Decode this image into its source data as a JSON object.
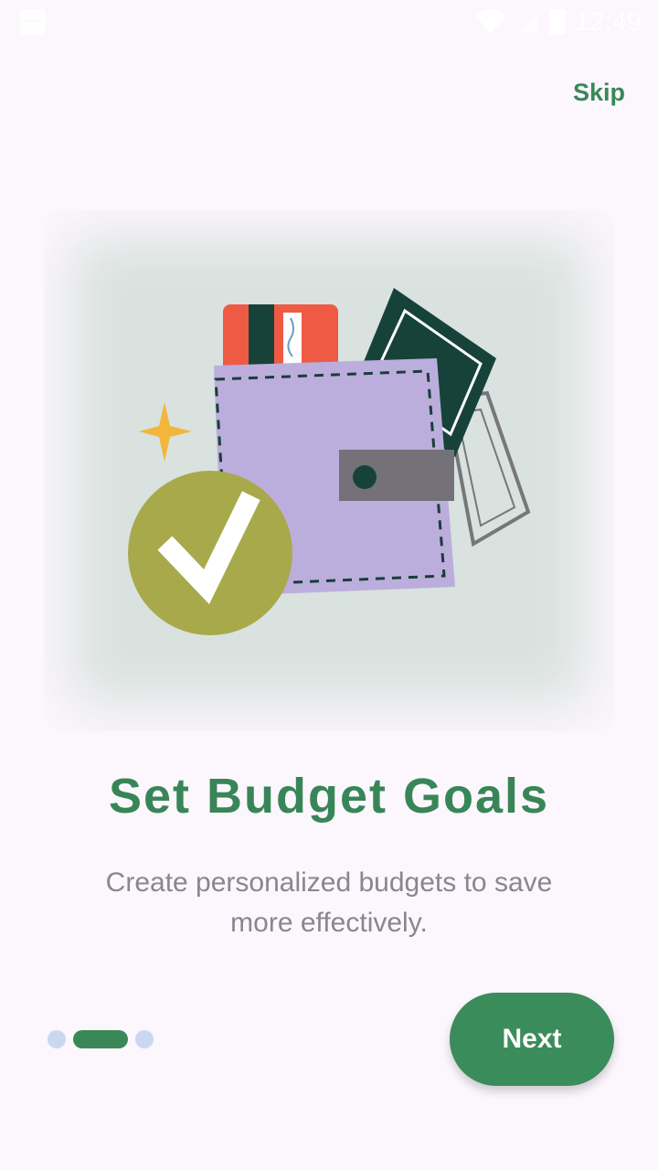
{
  "status_bar": {
    "time": "12:49",
    "icons": [
      "app-notification-icon",
      "wifi-icon",
      "signal-icon",
      "battery-icon"
    ]
  },
  "header": {
    "skip_label": "Skip"
  },
  "illustration": {
    "icons": [
      "wallet-icon",
      "credit-card-icon",
      "banknote-icon",
      "sparkle-icon",
      "checkmark-icon"
    ]
  },
  "content": {
    "title": "Set Budget Goals",
    "subtitle": "Create personalized budgets to save more effectively."
  },
  "pagination": {
    "total": 3,
    "active_index": 1
  },
  "footer": {
    "next_label": "Next"
  },
  "colors": {
    "background": "#FCF6FD",
    "primary": "#398858",
    "dot_inactive": "#C9D8F0",
    "text_muted": "#8A8590"
  }
}
